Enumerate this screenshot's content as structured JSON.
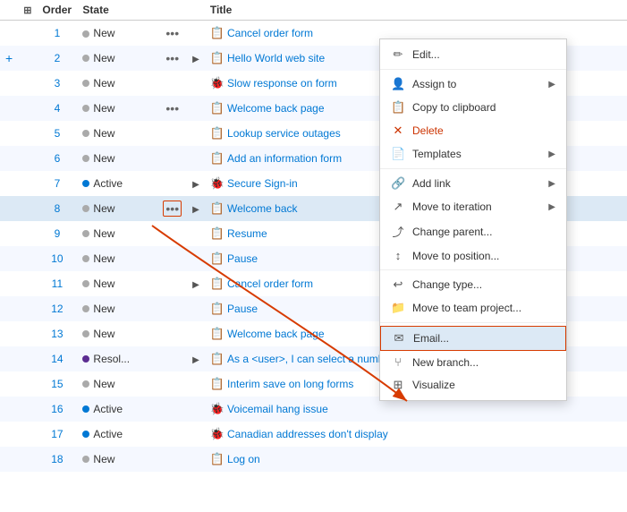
{
  "header": {
    "cols": [
      "",
      "",
      "Order",
      "State",
      "",
      "",
      "Title"
    ]
  },
  "rows": [
    {
      "order": "1",
      "state": "New",
      "stateType": "new",
      "hasDots": true,
      "hasArrow": false,
      "titleIcon": "book",
      "title": "Cancel order form",
      "titleLink": true
    },
    {
      "order": "2",
      "state": "New",
      "stateType": "new",
      "hasDots": true,
      "hasArrow": true,
      "titleIcon": "book",
      "title": "Hello World web site",
      "titleLink": true,
      "addRow": true
    },
    {
      "order": "3",
      "state": "New",
      "stateType": "new",
      "hasDots": false,
      "hasArrow": false,
      "titleIcon": "bug",
      "title": "Slow response on form",
      "titleLink": true
    },
    {
      "order": "4",
      "state": "New",
      "stateType": "new",
      "hasDots": true,
      "hasArrow": false,
      "titleIcon": "book",
      "title": "Welcome back page",
      "titleLink": true
    },
    {
      "order": "5",
      "state": "New",
      "stateType": "new",
      "hasDots": false,
      "hasArrow": false,
      "titleIcon": "book",
      "title": "Lookup service outages",
      "titleLink": true
    },
    {
      "order": "6",
      "state": "New",
      "stateType": "new",
      "hasDots": false,
      "hasArrow": false,
      "titleIcon": "book",
      "title": "Add an information form",
      "titleLink": true
    },
    {
      "order": "7",
      "state": "Active",
      "stateType": "active",
      "hasDots": false,
      "hasArrow": true,
      "titleIcon": "bug",
      "title": "Secure Sign-in",
      "titleLink": true
    },
    {
      "order": "8",
      "state": "New",
      "stateType": "new",
      "hasDots": true,
      "hasArrow": true,
      "titleIcon": "book",
      "title": "Welcome back",
      "titleLink": true,
      "selectedRow": true
    },
    {
      "order": "9",
      "state": "New",
      "stateType": "new",
      "hasDots": false,
      "hasArrow": false,
      "titleIcon": "book",
      "title": "Resume",
      "titleLink": true
    },
    {
      "order": "10",
      "state": "New",
      "stateType": "new",
      "hasDots": false,
      "hasArrow": false,
      "titleIcon": "book",
      "title": "Pause",
      "titleLink": true
    },
    {
      "order": "11",
      "state": "New",
      "stateType": "new",
      "hasDots": false,
      "hasArrow": true,
      "titleIcon": "book",
      "title": "Cancel order form",
      "titleLink": true
    },
    {
      "order": "12",
      "state": "New",
      "stateType": "new",
      "hasDots": false,
      "hasArrow": false,
      "titleIcon": "book",
      "title": "Pause",
      "titleLink": true
    },
    {
      "order": "13",
      "state": "New",
      "stateType": "new",
      "hasDots": false,
      "hasArrow": false,
      "titleIcon": "book",
      "title": "Welcome back page",
      "titleLink": true
    },
    {
      "order": "14",
      "state": "Resol...",
      "stateType": "resolve",
      "hasDots": false,
      "hasArrow": true,
      "titleIcon": "book",
      "title": "As a <user>, I can select a numbe",
      "titleLink": true
    },
    {
      "order": "15",
      "state": "New",
      "stateType": "new",
      "hasDots": false,
      "hasArrow": false,
      "titleIcon": "book",
      "title": "Interim save on long forms",
      "titleLink": true
    },
    {
      "order": "16",
      "state": "Active",
      "stateType": "active",
      "hasDots": false,
      "hasArrow": false,
      "titleIcon": "bug",
      "title": "Voicemail hang issue",
      "titleLink": true
    },
    {
      "order": "17",
      "state": "Active",
      "stateType": "active",
      "hasDots": false,
      "hasArrow": false,
      "titleIcon": "bug",
      "title": "Canadian addresses don't display",
      "titleLink": true
    },
    {
      "order": "18",
      "state": "New",
      "stateType": "new",
      "hasDots": false,
      "hasArrow": false,
      "titleIcon": "book",
      "title": "Log on",
      "titleLink": true
    }
  ],
  "contextMenu": {
    "items": [
      {
        "id": "edit",
        "icon": "✏️",
        "label": "Edit...",
        "hasArrow": false
      },
      {
        "id": "assign-to",
        "icon": "👤",
        "label": "Assign to",
        "hasArrow": true
      },
      {
        "id": "copy-clipboard",
        "icon": "📋",
        "label": "Copy to clipboard",
        "hasArrow": false
      },
      {
        "id": "delete",
        "icon": "✕",
        "label": "Delete",
        "hasArrow": false,
        "isDelete": true
      },
      {
        "id": "templates",
        "icon": "📄",
        "label": "Templates",
        "hasArrow": true
      },
      {
        "id": "add-link",
        "icon": "🔗",
        "label": "Add link",
        "hasArrow": true
      },
      {
        "id": "move-iteration",
        "icon": "↗",
        "label": "Move to iteration",
        "hasArrow": true
      },
      {
        "id": "change-parent",
        "icon": "⤴",
        "label": "Change parent...",
        "hasArrow": false
      },
      {
        "id": "move-position",
        "icon": "↕",
        "label": "Move to position...",
        "hasArrow": false
      },
      {
        "id": "change-type",
        "icon": "↩",
        "label": "Change type...",
        "hasArrow": false
      },
      {
        "id": "move-team",
        "icon": "📦",
        "label": "Move to team project...",
        "hasArrow": false
      },
      {
        "id": "email",
        "icon": "✉",
        "label": "Email...",
        "hasArrow": false,
        "highlighted": true
      },
      {
        "id": "new-branch",
        "icon": "⑂",
        "label": "New branch...",
        "hasArrow": false
      },
      {
        "id": "visualize",
        "icon": "⊞",
        "label": "Visualize",
        "hasArrow": false
      }
    ]
  }
}
